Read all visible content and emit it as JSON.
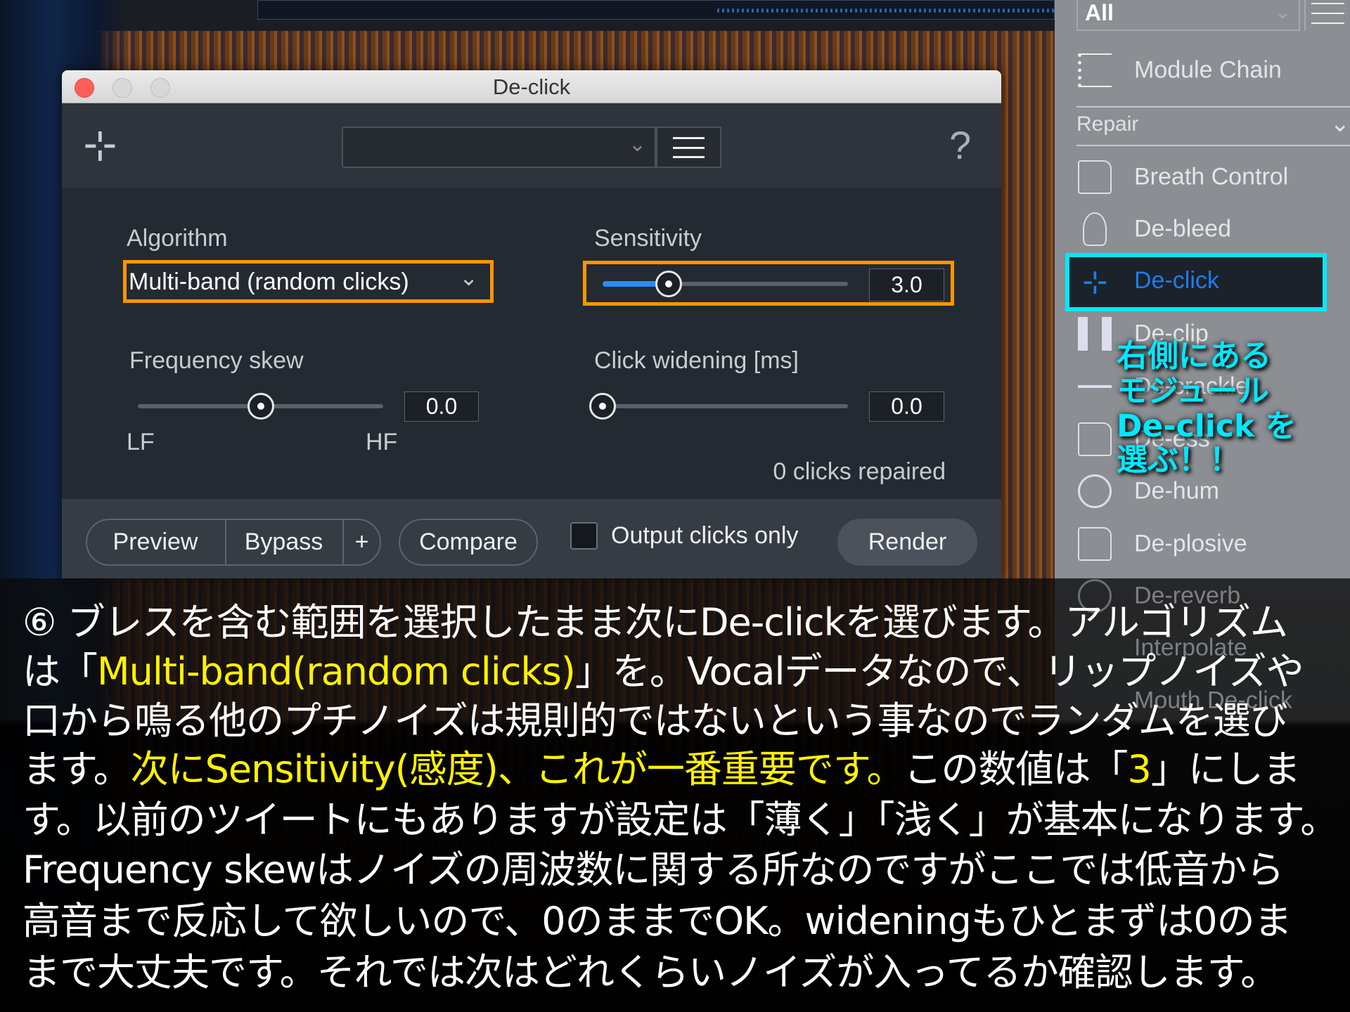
{
  "dialog": {
    "title": "De-click",
    "preset_value": "",
    "help": "?",
    "algorithm": {
      "label": "Algorithm",
      "value": "Multi-band (random clicks)"
    },
    "sensitivity": {
      "label": "Sensitivity",
      "value": "3.0",
      "fraction": 0.27
    },
    "frequency_skew": {
      "label": "Frequency skew",
      "value": "0.0",
      "low": "LF",
      "high": "HF",
      "fraction": 0.5
    },
    "click_widening": {
      "label": "Click widening [ms]",
      "value": "0.0",
      "fraction": 0.0
    },
    "status": "0 clicks repaired",
    "footer": {
      "preview": "Preview",
      "bypass": "Bypass",
      "plus": "+",
      "compare": "Compare",
      "output_only": "Output clicks only",
      "output_only_checked": false,
      "render": "Render"
    }
  },
  "panel": {
    "filter": "All",
    "module_chain": "Module Chain",
    "section": "Repair",
    "items": [
      "Breath Control",
      "De-bleed",
      "De-click",
      "De-clip",
      "De-crackle",
      "De-ess",
      "De-hum",
      "De-plosive",
      "De-reverb",
      "Interpolate",
      "Mouth De-click"
    ],
    "selected": "De-click",
    "highlight_color": "#00e8ff",
    "selected_text_color": "#1e7cf0"
  },
  "annotation": [
    "右側にある",
    "モジュール",
    "De-click を",
    "選ぶ！！"
  ],
  "caption": {
    "l1": "⑥ ブレスを含む範囲を選択したまま次にDe-clickを選びます。アルゴリズム",
    "l2a": "は「",
    "l2b": "Multi-band(random clicks)",
    "l2c": "」を。Vocalデータなので、リップノイズや",
    "l3": "口から鳴る他のプチノイズは規則的ではないという事なのでランダムを選び",
    "l4a": "ます。",
    "l4b": "次にSensitivity(感度)、これが一番重要です。",
    "l4c": "この数値は「",
    "l4d": "3",
    "l4e": "」にしま",
    "l5": "す。以前のツイートにもありますが設定は「薄く」「浅く」が基本になります。",
    "l6": "Frequency skewはノイズの周波数に関する所なのですがここでは低音から",
    "l7": "高音まで反応して欲しいので、0のままでOK。wideningもひとまずは0のま",
    "l8": "まで大丈夫です。それでは次はどれくらいノイズが入ってるか確認します。",
    "highlight_color": "#fff200"
  }
}
